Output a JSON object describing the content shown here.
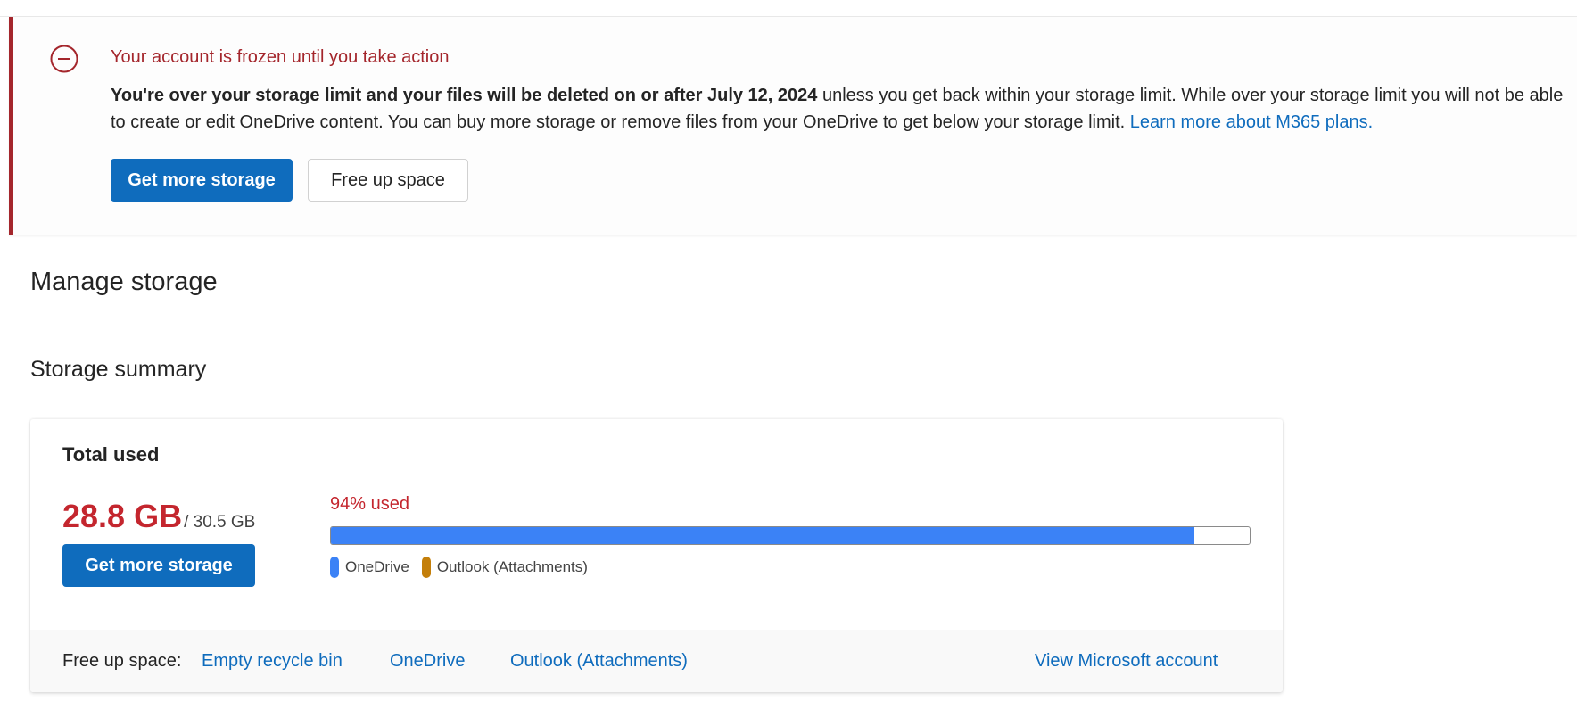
{
  "banner": {
    "title": "Your account is frozen until you take action",
    "body_bold": "You're over your storage limit and your files will be deleted on or after July 12, 2024",
    "body_rest": " unless you get back within your storage limit. While over your storage limit you will not be able to create or edit OneDrive content. You can buy more storage or remove files from your OneDrive to get below your storage limit. ",
    "link_text": "Learn more about M365 plans.",
    "primary_button": "Get more storage",
    "secondary_button": "Free up space",
    "icon": "minus-circle-icon",
    "accent_color": "#a4262c"
  },
  "page": {
    "title": "Manage storage"
  },
  "summary": {
    "section_title": "Storage summary",
    "total_label": "Total used",
    "used": "28.8 GB",
    "of_total": "/ 30.5 GB",
    "button": "Get more storage",
    "percent_label": "94% used",
    "percent_used": 94,
    "legend": [
      {
        "label": "OneDrive",
        "color": "#3b82f6"
      },
      {
        "label": "Outlook (Attachments)",
        "color": "#c47f0a"
      }
    ],
    "footer": {
      "label": "Free up space:",
      "links": [
        "Empty recycle bin",
        "OneDrive",
        "Outlook (Attachments)",
        "View Microsoft account"
      ]
    },
    "alert_color": "#c4262e",
    "primary_color": "#0f6cbd"
  }
}
